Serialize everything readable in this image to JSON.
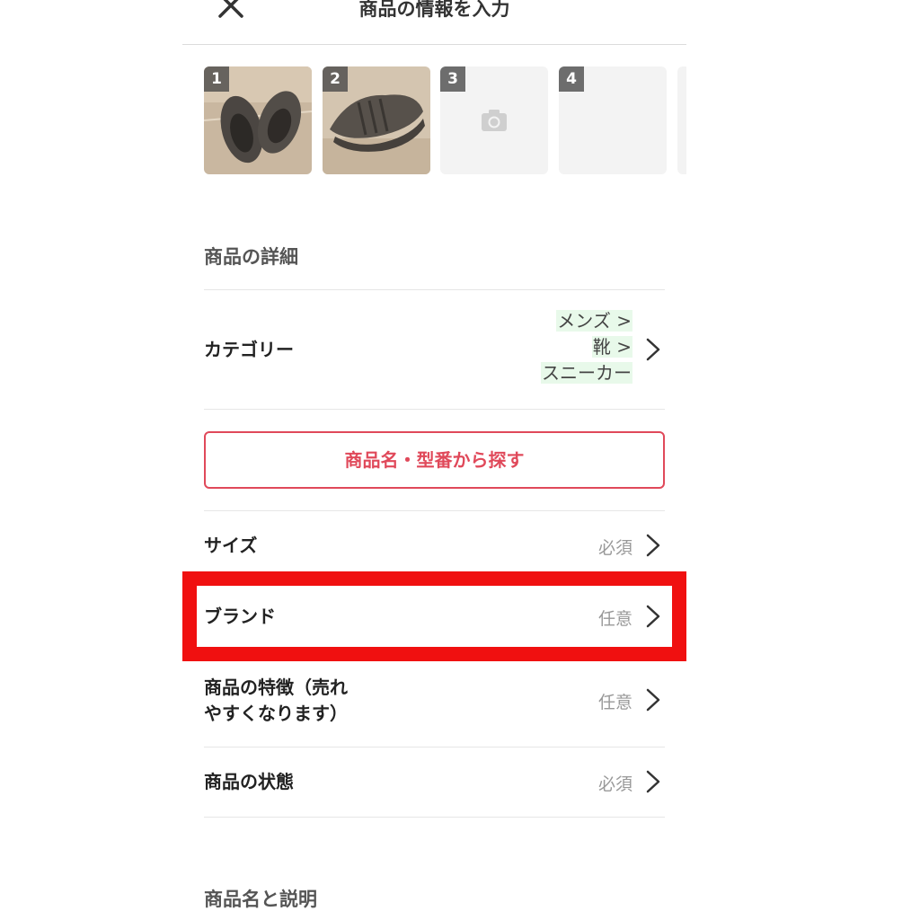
{
  "header": {
    "title": "商品の情報を入力"
  },
  "photos": [
    {
      "number": "1"
    },
    {
      "number": "2"
    },
    {
      "number": "3"
    },
    {
      "number": "4"
    }
  ],
  "details": {
    "section_title": "商品の詳細",
    "category": {
      "label": "カテゴリー",
      "values": [
        "メンズ >",
        "靴 >",
        "スニーカー"
      ]
    },
    "search_button": "商品名・型番から探す",
    "rows": [
      {
        "label": "サイズ",
        "value": "必須"
      },
      {
        "label": "ブランド",
        "value": "任意"
      },
      {
        "label_line1": "商品の特徴（売れ",
        "label_line2": "やすくなります）",
        "value": "任意"
      },
      {
        "label": "商品の状態",
        "value": "必須"
      }
    ]
  },
  "name_section": {
    "section_title": "商品名と説明"
  },
  "colors": {
    "accent": "#e0495a",
    "highlight": "#f01010",
    "category_bg": "#e8f9ea"
  }
}
